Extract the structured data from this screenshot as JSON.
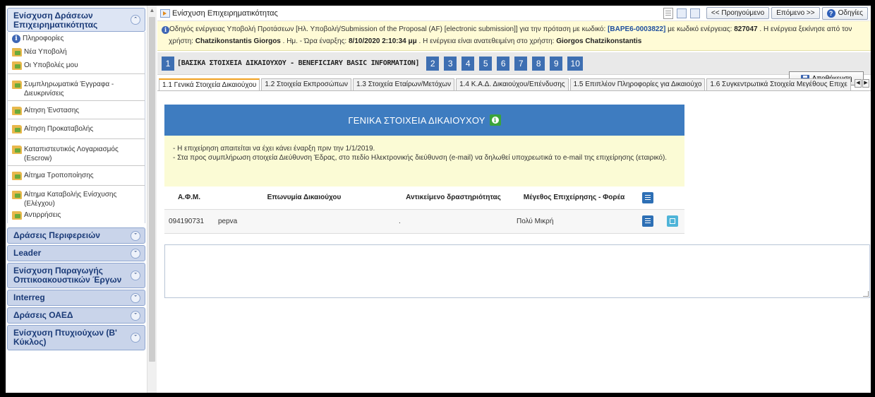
{
  "sidebar": {
    "open_group": {
      "title": "Ενίσχυση Δράσεων Επιχειρηματικότητας",
      "items": [
        {
          "label": "Πληροφορίες",
          "icon": "info-icon"
        },
        {
          "label": "Νέα Υποβολή",
          "icon": "folder-icon"
        },
        {
          "label": "Οι Υποβολές μου",
          "icon": "folder-icon"
        },
        {
          "label": "Συμπληρωματικά Έγγραφα - Διευκρινίσεις",
          "icon": "folder-icon"
        },
        {
          "label": "Αίτηση Ένστασης",
          "icon": "folder-icon"
        },
        {
          "label": "Αίτηση Προκαταβολής",
          "icon": "folder-icon"
        },
        {
          "label": "Καταπιστευτικός Λογαριασμός (Escrow)",
          "icon": "folder-icon"
        },
        {
          "label": "Αίτημα Τροποποίησης",
          "icon": "folder-icon"
        },
        {
          "label": "Αίτημα Καταβολής Ενίσχυσης (Ελέγχου)",
          "icon": "folder-icon"
        },
        {
          "label": "Αντιρρήσεις",
          "icon": "folder-icon"
        }
      ]
    },
    "groups": [
      "Δράσεις Περιφερειών",
      "Leader",
      "Ενίσχυση Παραγωγής Οπτικοακουστικών Έργων",
      "Interreg",
      "Δράσεις ΟΑΕΔ",
      "Ενίσχυση Πτυχιούχων (Β' Κύκλος)"
    ]
  },
  "toolbar": {
    "title": "Ενίσχυση Επιχειρηματικότητας",
    "prev_label": "<< Προηγούμενο",
    "next_label": "Επόμενο >>",
    "help_label": "Οδηγίες"
  },
  "info": {
    "prefix": "Οδηγός ενέργειας Υποβολή Προτάσεων [Ηλ. Υποβολή/Submission of the Proposal (AF) [electronic submission]] για την πρόταση με κωδικό: ",
    "proposal_code": "[ΒΑΡΕ6-0003822]",
    "mid1": " με κωδικό ενέργειας: ",
    "action_code": "827047",
    "mid2": " . Η ενέργεια ξεκίνησε από τον",
    "line2_prefix": "χρήστη: ",
    "user": "Chatzikonstantis Giorgos",
    "mid3": " . Ημ. - Ώρα έναρξης: ",
    "start_dt": "8/10/2020 2:10:34 μμ",
    "mid4": " . Η ενέργεια είναι ανατεθειμένη στο χρήστη: ",
    "assignee": "Giorgos Chatzikonstantis"
  },
  "steps": {
    "current": "1",
    "current_label": "[ΒΑΣΙΚΑ ΣΤΟΙΧΕΙΑ ΔΙΚΑΙΟΥΧΟΥ - BENEFICIARY BASIC INFORMATION]",
    "others": [
      "2",
      "3",
      "4",
      "5",
      "6",
      "7",
      "8",
      "9",
      "10"
    ],
    "save_label": "Αποθήκευση"
  },
  "tabs": [
    "1.1 Γενικά Στοιχεία Δικαιούχου",
    "1.2 Στοιχεία Εκπροσώπων",
    "1.3 Στοιχεία Εταίρων/Μετόχων",
    "1.4 Κ.Α.Δ. Δικαιούχου/Επένδυσης",
    "1.5 Επιπλέον Πληροφορίες για Δικαιούχο",
    "1.6 Συγκεντρωτικά Στοιχεία Μεγέθους Επιχε"
  ],
  "panel": {
    "title": "ΓΕΝΙΚΑ ΣΤΟΙΧΕΙΑ ΔΙΚΑΙΟΥΧΟΥ",
    "note1": "- Η επιχείρηση απαιτείται να έχει κάνει έναρξη πριν την 1/1/2019.",
    "note2": "- Στα προς συμπλήρωση στοιχεία Διεύθυνση Έδρας, στο πεδίο Ηλεκτρονικής διεύθυνση (e-mail) να δηλωθεί υποχρεωτικά το e-mail της επιχείρησης (εταιρικό).",
    "columns": [
      "Α.Φ.Μ.",
      "Επωνυμία Δικαιούχου",
      "Αντικείμενο δραστηριότητας",
      "Μέγεθος Επιχείρησης - Φορέα"
    ],
    "row": {
      "afm": "094190731",
      "name": "pepva",
      "activity": ".",
      "size": "Πολύ Μικρή"
    }
  },
  "colors": {
    "accent_blue": "#3e7cc0",
    "step_blue": "#3e6fb2",
    "info_bg": "#fffbd6"
  }
}
